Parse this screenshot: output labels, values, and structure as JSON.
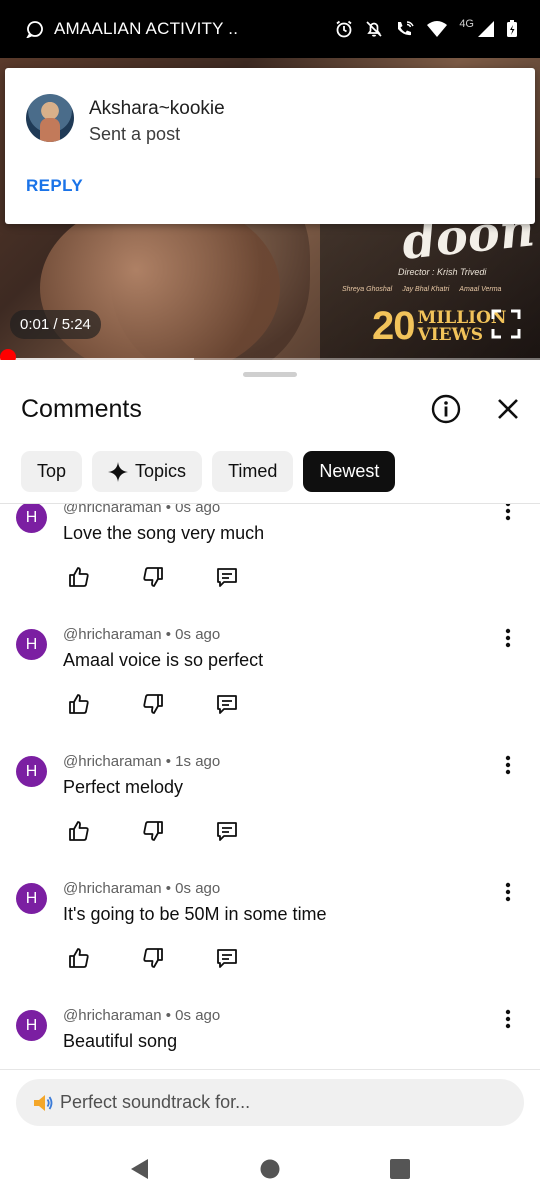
{
  "status_bar": {
    "notification_text": "AMAALIAN ACTIVITY ..",
    "network": "4G",
    "icons": [
      "message-icon",
      "alarm-icon",
      "mute-icon",
      "call-wifi-icon",
      "wifi-icon",
      "signal-icon",
      "battery-icon"
    ]
  },
  "video": {
    "time": "0:01 / 5:24",
    "title_art": "doon",
    "director": "Director : Krish Trivedi",
    "credits": [
      "Shreya Ghoshal",
      "Jay Bhal Khatri",
      "Amaal Verma"
    ],
    "views_number": "20",
    "views_word_1": "MILLION",
    "views_word_2": "VIEWS",
    "progress_fraction": 0.0,
    "buffer_fraction": 0.36
  },
  "notification": {
    "name": "Akshara~kookie",
    "text": "Sent a post",
    "action": "REPLY"
  },
  "comments_panel": {
    "title": "Comments",
    "chips": [
      {
        "label": "Top",
        "active": false
      },
      {
        "label": "Topics",
        "active": false,
        "icon": "sparkle-icon"
      },
      {
        "label": "Timed",
        "active": false
      },
      {
        "label": "Newest",
        "active": true
      }
    ],
    "comments": [
      {
        "avatar": "H",
        "meta": "@hricharaman • 0s ago",
        "text": "Love the song very much"
      },
      {
        "avatar": "H",
        "meta": "@hricharaman • 0s ago",
        "text": "Amaal voice is so perfect"
      },
      {
        "avatar": "H",
        "meta": "@hricharaman • 1s ago",
        "text": "Perfect melody"
      },
      {
        "avatar": "H",
        "meta": "@hricharaman • 0s ago",
        "text": "It's going to be 50M in some time"
      },
      {
        "avatar": "H",
        "meta": "@hricharaman • 0s ago",
        "text": "Beautiful song"
      }
    ],
    "input_placeholder": "Perfect soundtrack for..."
  },
  "colors": {
    "avatar": "#7b1fa2",
    "reply": "#1a73e8",
    "progress": "#ff0000",
    "active_chip": "#0f0f0f"
  }
}
